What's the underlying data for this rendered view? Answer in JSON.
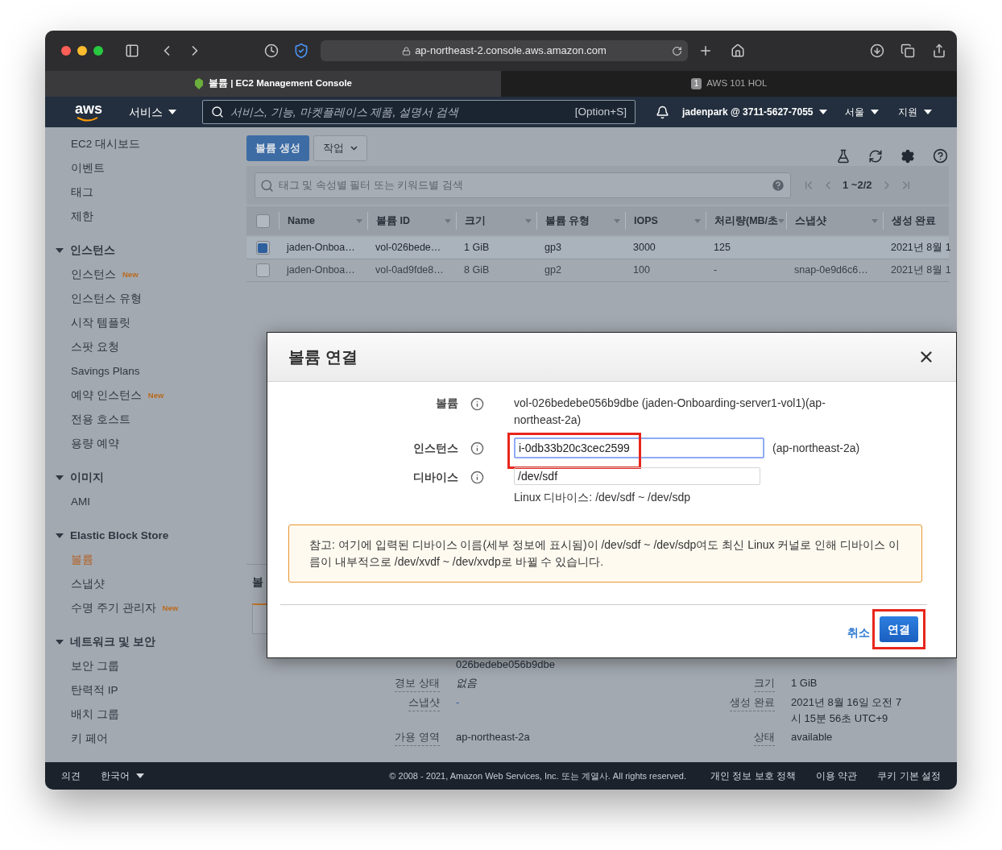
{
  "browser": {
    "url": "ap-northeast-2.console.aws.amazon.com",
    "tabs": [
      {
        "title": "볼륨 | EC2 Management Console",
        "selected": true
      },
      {
        "badge": "1",
        "title": "AWS 101 HOL",
        "selected": false
      }
    ]
  },
  "topnav": {
    "logo": "aws",
    "services": "서비스",
    "search_placeholder": "서비스, 기능, 마켓플레이스 제품, 설명서 검색",
    "shortcut": "[Option+S]",
    "account": "jadenpark @ 3711-5627-7055",
    "region": "서울",
    "support": "지원"
  },
  "sidebar": {
    "items": [
      {
        "label": "EC2 대시보드",
        "selected": false
      },
      {
        "label": "이벤트",
        "selected": false
      },
      {
        "label": "태그",
        "selected": false
      },
      {
        "label": "제한",
        "selected": false
      }
    ],
    "sections": [
      {
        "label": "인스턴스",
        "expanded": true,
        "items": [
          {
            "label": "인스턴스",
            "badge": "New",
            "selected": false
          },
          {
            "label": "인스턴스 유형",
            "selected": false
          },
          {
            "label": "시작 템플릿",
            "selected": false
          },
          {
            "label": "스팟 요청",
            "selected": false
          },
          {
            "label": "Savings Plans",
            "selected": false
          },
          {
            "label": "예약 인스턴스",
            "badge": "New",
            "selected": false
          },
          {
            "label": "전용 호스트",
            "selected": false
          },
          {
            "label": "용량 예약",
            "selected": false
          }
        ]
      },
      {
        "label": "이미지",
        "expanded": true,
        "items": [
          {
            "label": "AMI",
            "selected": false
          }
        ]
      },
      {
        "label": "Elastic Block Store",
        "expanded": true,
        "items": [
          {
            "label": "볼륨",
            "selected": true
          },
          {
            "label": "스냅샷",
            "selected": false
          },
          {
            "label": "수명 주기 관리자",
            "badge": "New",
            "selected": false
          }
        ]
      },
      {
        "label": "네트워크 및 보안",
        "expanded": true,
        "items": [
          {
            "label": "보안 그룹",
            "selected": false
          },
          {
            "label": "탄력적 IP",
            "selected": false
          },
          {
            "label": "배치 그룹",
            "selected": false
          },
          {
            "label": "키 페어",
            "selected": false
          }
        ]
      }
    ]
  },
  "toolbar": {
    "create": "볼륨 생성",
    "actions": "작업"
  },
  "filter": {
    "placeholder": "태그 및 속성별 필터 또는 키워드별 검색",
    "range": "1 ~2/2"
  },
  "table": {
    "all_checked": false,
    "columns": [
      {
        "label": "Name",
        "sortable": true
      },
      {
        "label": "볼륨 ID",
        "sortable": true
      },
      {
        "label": "크기",
        "sortable": true
      },
      {
        "label": "볼륨 유형",
        "sortable": true
      },
      {
        "label": "IOPS",
        "sortable": true
      },
      {
        "label": "처리량(MB/초",
        "sortable": true
      },
      {
        "label": "스냅샷",
        "sortable": true
      },
      {
        "label": "생성 완료",
        "sortable": false
      }
    ],
    "rows": [
      {
        "selected": true,
        "cells": [
          "jaden-Onboa…",
          "vol-026bede…",
          "1 GiB",
          "gp3",
          "3000",
          "125",
          null,
          "2021년 8월 1"
        ]
      },
      {
        "selected": false,
        "cells": [
          "jaden-Onboa…",
          "vol-0ad9fde8…",
          "8 GiB",
          "gp2",
          "100",
          "-",
          "snap-0e9d6c6…",
          "2021년 8월 1"
        ]
      }
    ]
  },
  "details": {
    "heading": "볼",
    "rows": [
      {
        "left": {
          "value": "026bedebe056b9dbe",
          "kind": "text"
        }
      },
      {
        "left": {
          "label": "경보 상태",
          "value": "없음",
          "kind": "none"
        },
        "right": {
          "label": "크기",
          "value": "1 GiB",
          "kind": "text"
        }
      },
      {
        "left": {
          "label": "스냅샷",
          "value": "-",
          "kind": "link"
        },
        "right": {
          "label": "생성 완료",
          "value": "2021년 8월 16일 오전 7 시 15분 56초 UTC+9",
          "kind": "text"
        }
      },
      {
        "left": {
          "label": "가용 영역",
          "value": "ap-northeast-2a",
          "kind": "text"
        },
        "right": {
          "label": "상태",
          "value": "available",
          "kind": "text"
        }
      }
    ]
  },
  "modal": {
    "title": "볼륨 연결",
    "fields": [
      {
        "label": "볼륨",
        "kind": "text",
        "value": "vol-026bedebe056b9dbe (jaden-Onboarding-server1-vol1)(ap-northeast-2a)"
      },
      {
        "label": "인스턴스",
        "kind": "input",
        "value": "i-0db33b20c3cec2599",
        "focused": true,
        "highlighted": true,
        "suffix": "(ap-northeast-2a)"
      },
      {
        "label": "디바이스",
        "kind": "input",
        "value": "/dev/sdf",
        "focused": false,
        "hint": "Linux 디바이스: /dev/sdf ~ /dev/sdp"
      }
    ],
    "note": "참고: 여기에 입력된 디바이스 이름(세부 정보에 표시됨)이 /dev/sdf ~ /dev/sdp여도 최신 Linux 커널로 인해 디바이스 이름이 내부적으로 /dev/xvdf ~ /dev/xvdp로 바뀔 수 있습니다.",
    "cancel": "취소",
    "confirm": {
      "label": "연결",
      "highlighted": true
    }
  },
  "footer": {
    "feedback": "의견",
    "language": "한국어",
    "copyright": "© 2008 - 2021, Amazon Web Services, Inc. 또는 계열사. All rights reserved.",
    "links": [
      "개인 정보 보호 정책",
      "이용 약관",
      "쿠키 기본 설정"
    ]
  }
}
